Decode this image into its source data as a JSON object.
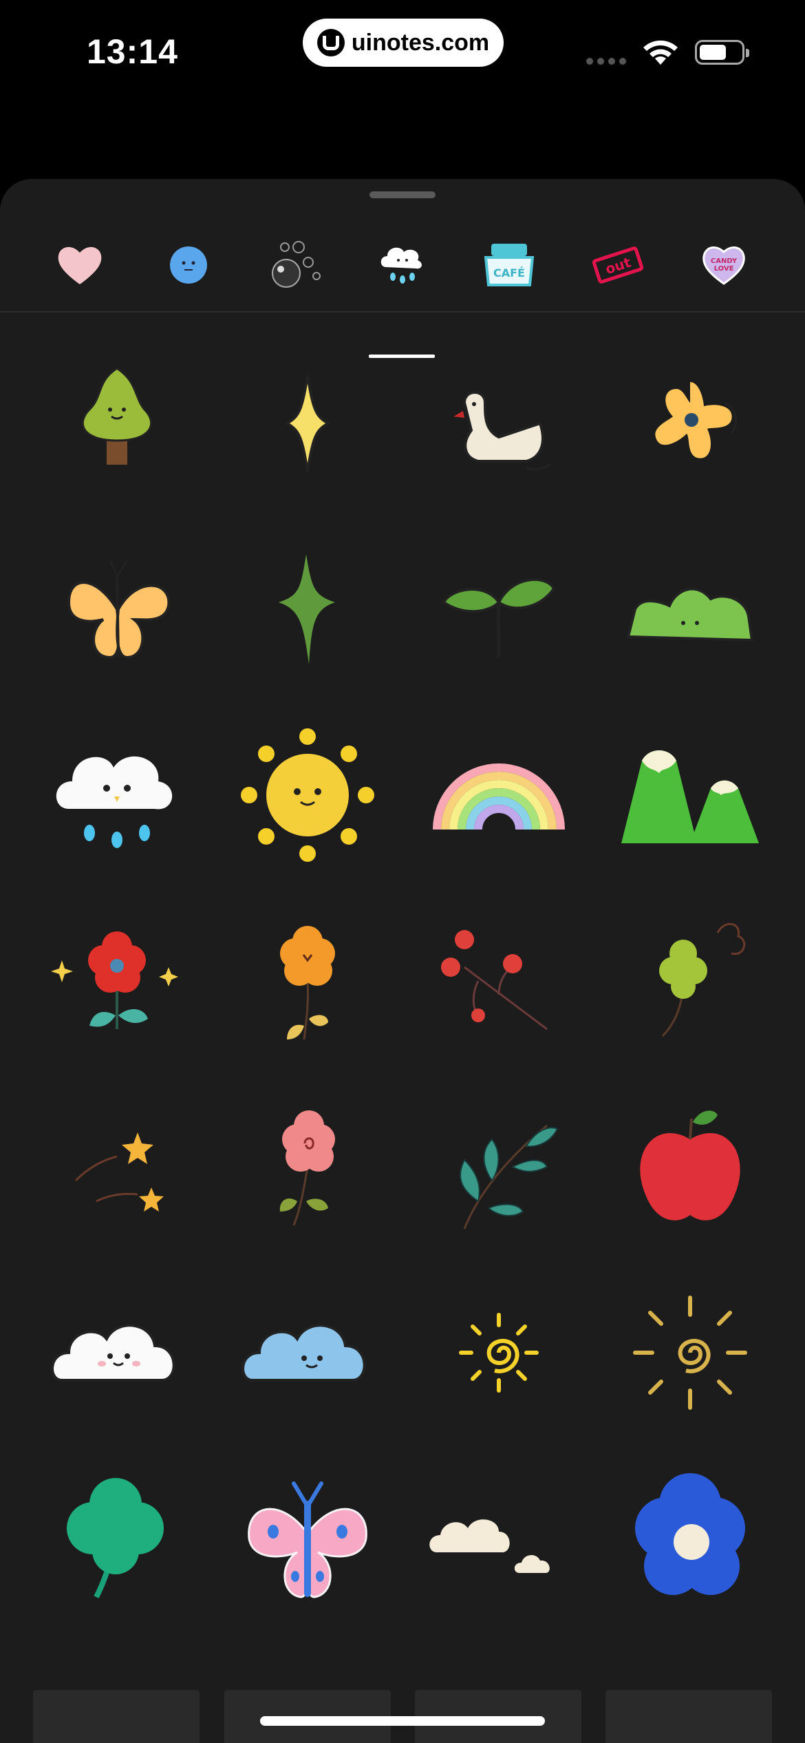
{
  "status_bar": {
    "time": "13:14",
    "url": "uinotes.com",
    "icons": [
      "cellular-icon",
      "wifi-icon",
      "battery-icon"
    ]
  },
  "sheet": {
    "tabs": [
      {
        "name": "heart-tab",
        "icon": "pink-heart-icon",
        "selected": false
      },
      {
        "name": "blue-face-tab",
        "icon": "blue-face-icon",
        "selected": false
      },
      {
        "name": "bubbles-tab",
        "icon": "bubbles-icon",
        "selected": false
      },
      {
        "name": "cloud-tab",
        "icon": "rain-cloud-icon",
        "selected": true
      },
      {
        "name": "cafe-tab",
        "icon": "cafe-sign-icon",
        "selected": false,
        "text": "CAFÉ"
      },
      {
        "name": "out-tab",
        "icon": "out-stamp-icon",
        "selected": false,
        "text": "out"
      },
      {
        "name": "candy-heart-tab",
        "icon": "candy-heart-icon",
        "selected": false,
        "text": "CANDY LOVE"
      }
    ],
    "stickers": [
      "tree-sticker",
      "sparkle-sticker",
      "duck-sticker",
      "yellow-flower-sticker",
      "butterfly-sticker",
      "green-sparkle-sticker",
      "sprout-sticker",
      "green-bush-sticker",
      "cloud-rain-sticker",
      "sun-face-sticker",
      "rainbow-sticker",
      "mountains-sticker",
      "red-flower-sticker",
      "orange-flower-sticker",
      "red-blossom-branch-sticker",
      "clover-doodle-sticker",
      "shooting-stars-sticker",
      "pink-flower-sticker",
      "leaf-branch-sticker",
      "apple-sticker",
      "white-cloud-sticker",
      "blue-cloud-sticker",
      "yellow-sun-doodle-sticker",
      "gold-sun-doodle-sticker",
      "green-clover-sticker",
      "pink-butterfly-sticker",
      "cream-clouds-sticker",
      "blue-flower-sticker"
    ],
    "colors": {
      "background": "#000000",
      "sheet": "#1c1c1c",
      "accent_white": "#ffffff"
    }
  }
}
